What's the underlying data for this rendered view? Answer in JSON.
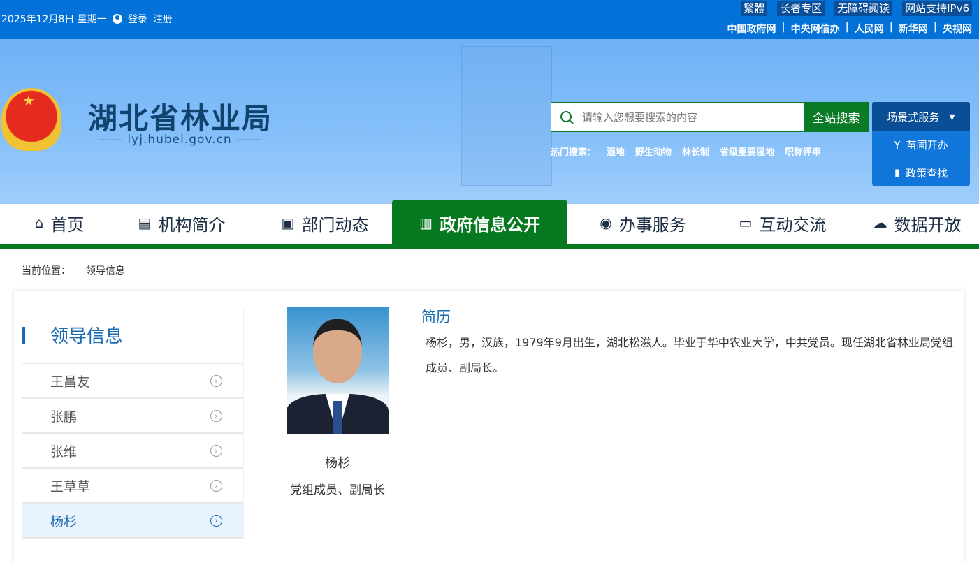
{
  "topbar": {
    "date": "2025年12月8日 星期一",
    "login": "登录",
    "register": "注册",
    "buttons": [
      "繁體",
      "长者专区",
      "无障碍阅读",
      "网站支持IPv6"
    ],
    "links": [
      "中国政府网",
      "中央网信办",
      "人民网",
      "新华网",
      "央视网"
    ]
  },
  "header": {
    "title": "湖北省林业局",
    "url": "lyj.hubei.gov.cn",
    "search_placeholder": "请输入您想要搜索的内容",
    "search_button": "全站搜索",
    "hot_label": "热门搜索：",
    "hot": [
      "湿地",
      "野生动物",
      "林长制",
      "省级重要湿地",
      "职称评审"
    ],
    "scene": {
      "label": "场景式服务",
      "items": [
        "苗圃开办",
        "政策查找"
      ]
    }
  },
  "nav": [
    {
      "label": "首页",
      "icon": "home-icon"
    },
    {
      "label": "机构简介",
      "icon": "building-icon"
    },
    {
      "label": "部门动态",
      "icon": "news-icon"
    },
    {
      "label": "政府信息公开",
      "icon": "document-icon",
      "active": true
    },
    {
      "label": "办事服务",
      "icon": "emblem-icon"
    },
    {
      "label": "互动交流",
      "icon": "chat-icon"
    },
    {
      "label": "数据开放",
      "icon": "cloud-icon"
    }
  ],
  "breadcrumb": {
    "label": "当前位置：",
    "current": "领导信息"
  },
  "sidebar": {
    "title": "领导信息",
    "items": [
      "王昌友",
      "张鹏",
      "张维",
      "王草草",
      "杨杉"
    ]
  },
  "profile": {
    "name": "杨杉",
    "position": "党组成员、副局长",
    "resume_title": "简历",
    "resume": "杨杉，男，汉族，1979年9月出生，湖北松滋人。毕业于华中农业大学，中共党员。现任湖北省林业局党组成员、副局长。"
  },
  "colors": {
    "topbar": "#0272d9",
    "green": "#06781f",
    "accent": "#1a6ab3"
  }
}
